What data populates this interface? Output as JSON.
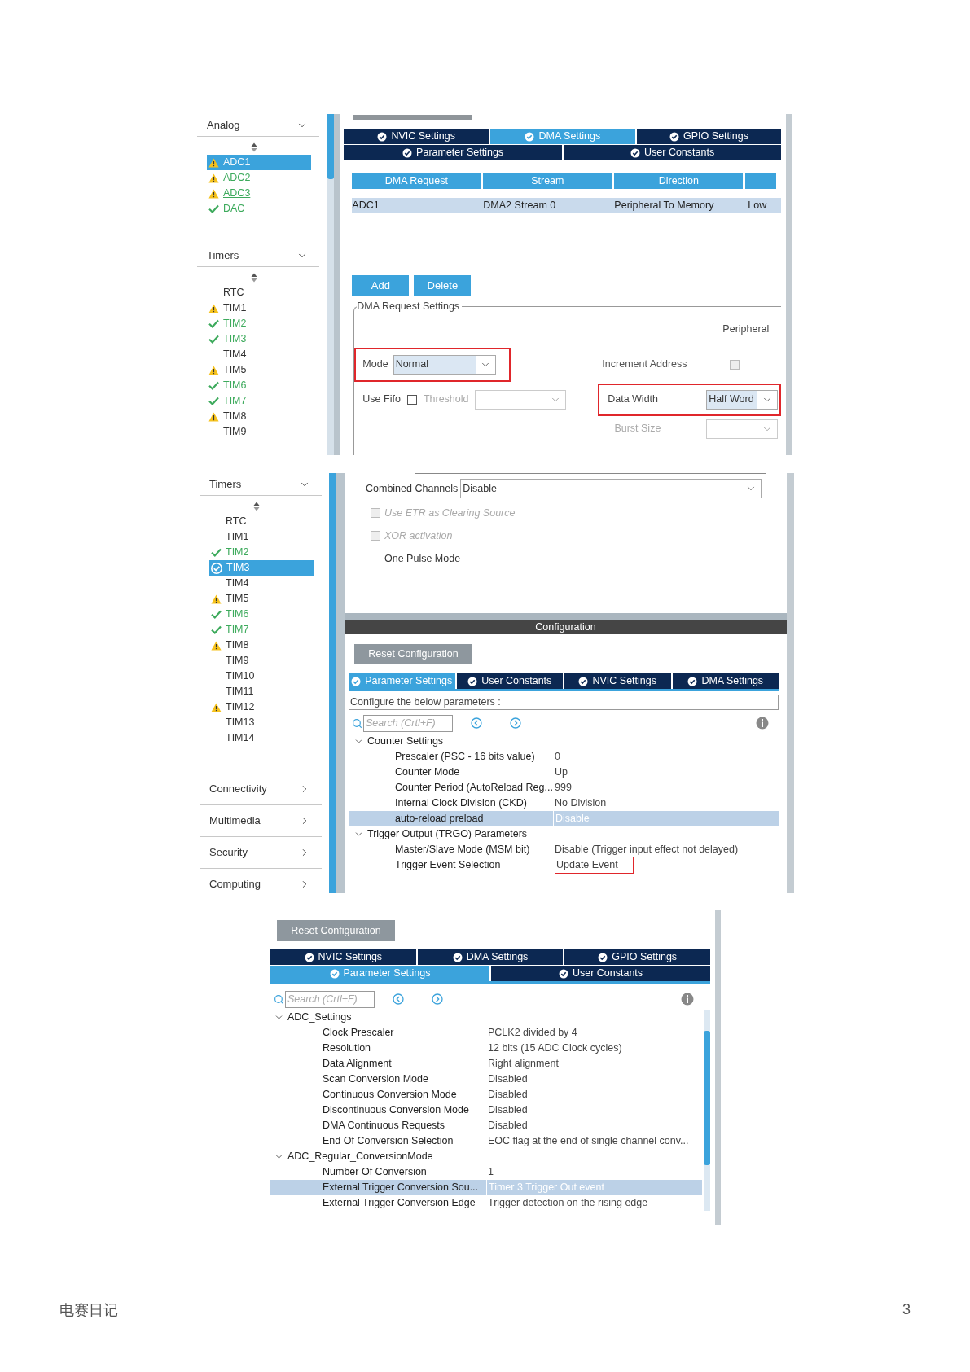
{
  "dma_screen": {
    "sidebar": [
      {
        "title": "Analog",
        "expanded": true,
        "items": [
          {
            "label": "ADC1",
            "kind": "warning",
            "enabled": false,
            "selected": true,
            "hovered": false
          },
          {
            "label": "ADC2",
            "kind": "warning",
            "enabled": true,
            "selected": false,
            "hovered": false
          },
          {
            "label": "ADC3",
            "kind": "warning",
            "enabled": true,
            "selected": false,
            "hovered": true
          },
          {
            "label": "DAC",
            "kind": "ok",
            "enabled": true,
            "selected": false,
            "hovered": false
          }
        ]
      },
      {
        "title": "Timers",
        "expanded": true,
        "items": [
          {
            "label": "RTC",
            "kind": "none",
            "enabled": false,
            "selected": false,
            "hovered": false
          },
          {
            "label": "TIM1",
            "kind": "warning",
            "enabled": false,
            "selected": false,
            "hovered": false
          },
          {
            "label": "TIM2",
            "kind": "ok",
            "enabled": true,
            "selected": false,
            "hovered": false
          },
          {
            "label": "TIM3",
            "kind": "ok",
            "enabled": true,
            "selected": false,
            "hovered": false
          },
          {
            "label": "TIM4",
            "kind": "none",
            "enabled": false,
            "selected": false,
            "hovered": false
          },
          {
            "label": "TIM5",
            "kind": "warning",
            "enabled": false,
            "selected": false,
            "hovered": false
          },
          {
            "label": "TIM6",
            "kind": "ok",
            "enabled": true,
            "selected": false,
            "hovered": false
          },
          {
            "label": "TIM7",
            "kind": "ok",
            "enabled": true,
            "selected": false,
            "hovered": false
          },
          {
            "label": "TIM8",
            "kind": "warning",
            "enabled": false,
            "selected": false,
            "hovered": false
          },
          {
            "label": "TIM9",
            "kind": "none",
            "enabled": false,
            "selected": false,
            "hovered": false
          }
        ]
      }
    ],
    "tab_rows": [
      [
        {
          "label": "NVIC Settings",
          "selected": false
        },
        {
          "label": "DMA Settings",
          "selected": true
        },
        {
          "label": "GPIO Settings",
          "selected": false
        }
      ],
      [
        {
          "label": "Parameter Settings",
          "selected": false
        },
        {
          "label": "User Constants",
          "selected": false
        }
      ]
    ],
    "table": {
      "columns": [
        "DMA Request",
        "Stream",
        "Direction"
      ],
      "rows": [
        [
          "ADC1",
          "DMA2 Stream 0",
          "Peripheral To Memory",
          "Low"
        ]
      ]
    },
    "buttons": [
      "Add",
      "Delete"
    ],
    "settings": {
      "title": "DMA Request Settings",
      "column_heading": "Peripheral",
      "mode": {
        "label": "Mode",
        "value": "Normal",
        "highlighted": true
      },
      "increment_address": {
        "label": "Increment Address",
        "checked": false
      },
      "use_fifo": {
        "label": "Use Fifo",
        "checked": false
      },
      "threshold": {
        "label": "Threshold",
        "disabled": true
      },
      "data_width": {
        "label": "Data Width",
        "value": "Half Word",
        "highlighted": true
      },
      "burst_size": {
        "label": "Burst Size",
        "disabled": true
      }
    }
  },
  "timer_screen": {
    "sidebar": [
      {
        "title": "Timers",
        "expanded": true,
        "items": [
          {
            "label": "RTC",
            "kind": "none",
            "enabled": false,
            "selected": false,
            "hovered": false
          },
          {
            "label": "TIM1",
            "kind": "none",
            "enabled": false,
            "selected": false,
            "hovered": false
          },
          {
            "label": "TIM2",
            "kind": "ok",
            "enabled": true,
            "selected": false,
            "hovered": false
          },
          {
            "label": "TIM3",
            "kind": "ok",
            "enabled": true,
            "selected": true,
            "hovered": false
          },
          {
            "label": "TIM4",
            "kind": "none",
            "enabled": false,
            "selected": false,
            "hovered": false
          },
          {
            "label": "TIM5",
            "kind": "warning",
            "enabled": false,
            "selected": false,
            "hovered": false
          },
          {
            "label": "TIM6",
            "kind": "ok",
            "enabled": true,
            "selected": false,
            "hovered": false
          },
          {
            "label": "TIM7",
            "kind": "ok",
            "enabled": true,
            "selected": false,
            "hovered": false
          },
          {
            "label": "TIM8",
            "kind": "warning",
            "enabled": false,
            "selected": false,
            "hovered": false
          },
          {
            "label": "TIM9",
            "kind": "none",
            "enabled": false,
            "selected": false,
            "hovered": false
          },
          {
            "label": "TIM10",
            "kind": "none",
            "enabled": false,
            "selected": false,
            "hovered": false
          },
          {
            "label": "TIM11",
            "kind": "none",
            "enabled": false,
            "selected": false,
            "hovered": false
          },
          {
            "label": "TIM12",
            "kind": "warning",
            "enabled": false,
            "selected": false,
            "hovered": false
          },
          {
            "label": "TIM13",
            "kind": "none",
            "enabled": false,
            "selected": false,
            "hovered": false
          },
          {
            "label": "TIM14",
            "kind": "none",
            "enabled": false,
            "selected": false,
            "hovered": false
          }
        ]
      },
      {
        "title": "Connectivity",
        "expanded": false
      },
      {
        "title": "Multimedia",
        "expanded": false
      },
      {
        "title": "Security",
        "expanded": false
      },
      {
        "title": "Computing",
        "expanded": false
      }
    ],
    "combined_channels": {
      "label": "Combined Channels",
      "value": "Disable"
    },
    "checkboxes": [
      {
        "label": "Use ETR as Clearing Source",
        "checked": false,
        "disabled": true
      },
      {
        "label": "XOR activation",
        "checked": false,
        "disabled": true
      },
      {
        "label": "One Pulse Mode",
        "checked": false,
        "disabled": false
      }
    ],
    "configuration": {
      "title": "Configuration",
      "reset_button": "Reset Configuration",
      "tab_rows": [
        [
          {
            "label": "Parameter Settings",
            "selected": true
          },
          {
            "label": "User Constants",
            "selected": false
          },
          {
            "label": "NVIC Settings",
            "selected": false
          },
          {
            "label": "DMA Settings",
            "selected": false
          }
        ]
      ],
      "hint": "Configure the below parameters :",
      "search_placeholder": "Search (Crtl+F)",
      "groups": [
        {
          "title": "Counter Settings",
          "expanded": true,
          "params": [
            {
              "name": "Prescaler (PSC - 16 bits value)",
              "value": "0",
              "selected": false,
              "highlighted": false
            },
            {
              "name": "Counter Mode",
              "value": "Up",
              "selected": false,
              "highlighted": false
            },
            {
              "name": "Counter Period (AutoReload Reg...",
              "value": "999",
              "selected": false,
              "highlighted": false
            },
            {
              "name": "Internal Clock Division (CKD)",
              "value": "No Division",
              "selected": false,
              "highlighted": false
            },
            {
              "name": "auto-reload preload",
              "value": "Disable",
              "selected": true,
              "highlighted": false
            }
          ]
        },
        {
          "title": "Trigger Output (TRGO) Parameters",
          "expanded": true,
          "params": [
            {
              "name": "Master/Slave Mode (MSM bit)",
              "value": "Disable (Trigger input effect not delayed)",
              "selected": false,
              "highlighted": false
            },
            {
              "name": "Trigger Event Selection",
              "value": "Update Event",
              "selected": false,
              "highlighted": true
            }
          ]
        }
      ]
    }
  },
  "adc_screen": {
    "reset_button": "Reset Configuration",
    "tab_rows": [
      [
        {
          "label": "NVIC Settings",
          "selected": false
        },
        {
          "label": "DMA Settings",
          "selected": false
        },
        {
          "label": "GPIO Settings",
          "selected": false
        }
      ],
      [
        {
          "label": "Parameter Settings",
          "selected": true
        },
        {
          "label": "User Constants",
          "selected": false
        }
      ]
    ],
    "search_placeholder": "Search (Crtl+F)",
    "groups": [
      {
        "title": "ADC_Settings",
        "expanded": true,
        "params": [
          {
            "name": "Clock Prescaler",
            "value": "PCLK2 divided by 4",
            "selected": false,
            "highlighted": false
          },
          {
            "name": "Resolution",
            "value": "12 bits (15 ADC Clock cycles)",
            "selected": false,
            "highlighted": false
          },
          {
            "name": "Data Alignment",
            "value": "Right alignment",
            "selected": false,
            "highlighted": false
          },
          {
            "name": "Scan Conversion Mode",
            "value": "Disabled",
            "selected": false,
            "highlighted": false
          },
          {
            "name": "Continuous Conversion Mode",
            "value": "Disabled",
            "selected": false,
            "highlighted": false
          },
          {
            "name": "Discontinuous Conversion Mode",
            "value": "Disabled",
            "selected": false,
            "highlighted": false
          },
          {
            "name": "DMA Continuous Requests",
            "value": "Disabled",
            "selected": false,
            "highlighted": false
          },
          {
            "name": "End Of Conversion Selection",
            "value": "EOC flag at the end of single channel conv...",
            "selected": false,
            "highlighted": false
          }
        ]
      },
      {
        "title": "ADC_Regular_ConversionMode",
        "expanded": true,
        "params": [
          {
            "name": "Number Of Conversion",
            "value": "1",
            "selected": false,
            "highlighted": false
          },
          {
            "name": "External Trigger Conversion Sou...",
            "value": "Timer 3 Trigger Out event",
            "selected": true,
            "highlighted": false
          },
          {
            "name": "External Trigger Conversion Edge",
            "value": "Trigger detection on the rising edge",
            "selected": false,
            "highlighted": false
          }
        ]
      }
    ]
  },
  "footer": {
    "title": "电赛日记",
    "page_number": "3"
  }
}
